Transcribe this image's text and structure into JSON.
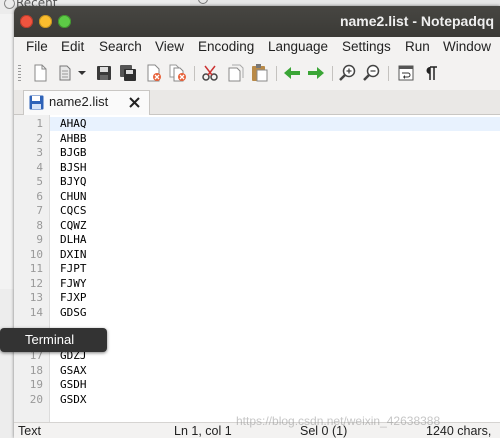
{
  "background": {
    "recent_label": "Recent"
  },
  "window": {
    "title": "name2.list - Notepadqq"
  },
  "menu": [
    "File",
    "Edit",
    "Search",
    "View",
    "Encoding",
    "Language",
    "Settings",
    "Run",
    "Window"
  ],
  "toolbar": {
    "icons": [
      "new-file-icon",
      "open-file-icon",
      "save-icon",
      "save-all-icon",
      "close-icon",
      "close-all-icon",
      "cut-icon",
      "copy-icon",
      "paste-icon",
      "undo-icon",
      "redo-icon",
      "zoom-in-icon",
      "zoom-out-icon",
      "word-wrap-icon",
      "show-all-characters-icon"
    ]
  },
  "tab": {
    "label": "name2.list"
  },
  "editor": {
    "lines": [
      {
        "num": "1",
        "text": "AHAQ"
      },
      {
        "num": "2",
        "text": "AHBB"
      },
      {
        "num": "3",
        "text": "BJGB"
      },
      {
        "num": "4",
        "text": "BJSH"
      },
      {
        "num": "5",
        "text": "BJYQ"
      },
      {
        "num": "6",
        "text": "CHUN"
      },
      {
        "num": "7",
        "text": "CQCS"
      },
      {
        "num": "8",
        "text": "CQWZ"
      },
      {
        "num": "9",
        "text": "DLHA"
      },
      {
        "num": "10",
        "text": "DXIN"
      },
      {
        "num": "11",
        "text": "FJPT"
      },
      {
        "num": "12",
        "text": "FJWY"
      },
      {
        "num": "13",
        "text": "FJXP"
      },
      {
        "num": "14",
        "text": "GDSG"
      },
      {
        "num": "17",
        "text": "GDZJ"
      },
      {
        "num": "18",
        "text": "GSAX"
      },
      {
        "num": "19",
        "text": "GSDH"
      },
      {
        "num": "20",
        "text": "GSDX"
      }
    ]
  },
  "status": {
    "mode": "Text",
    "position": "Ln 1, col 1",
    "selection": "Sel 0 (1)",
    "chars": "1240 chars,"
  },
  "watermark": "https://blog.csdn.net/weixin_42638388",
  "tooltip": {
    "label": "Terminal"
  }
}
